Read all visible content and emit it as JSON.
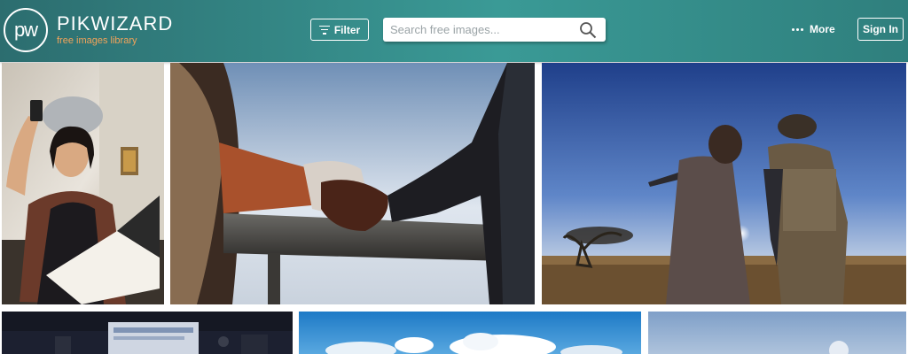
{
  "header": {
    "logo_mark": "pw",
    "logo_name": "PIKWIZARD",
    "logo_tagline": "free images library",
    "filter_label": "Filter",
    "search_placeholder": "Search free images...",
    "more_label": "More",
    "signin_label": "Sign In",
    "accent_color": "#3a9a96",
    "tagline_color": "#f2a35a"
  },
  "icons": {
    "filter": "filter-lines-icon",
    "search": "magnifier-icon",
    "more": "ellipsis-icon",
    "logo": "pw-circle-logo"
  },
  "photos": [
    {
      "name": "photo-woman-selfie-book"
    },
    {
      "name": "photo-hands-on-railing"
    },
    {
      "name": "photo-couple-sunset"
    },
    {
      "name": "photo-studio-monitor"
    },
    {
      "name": "photo-blue-sky-clouds"
    },
    {
      "name": "photo-hazy-sky-moon"
    }
  ]
}
